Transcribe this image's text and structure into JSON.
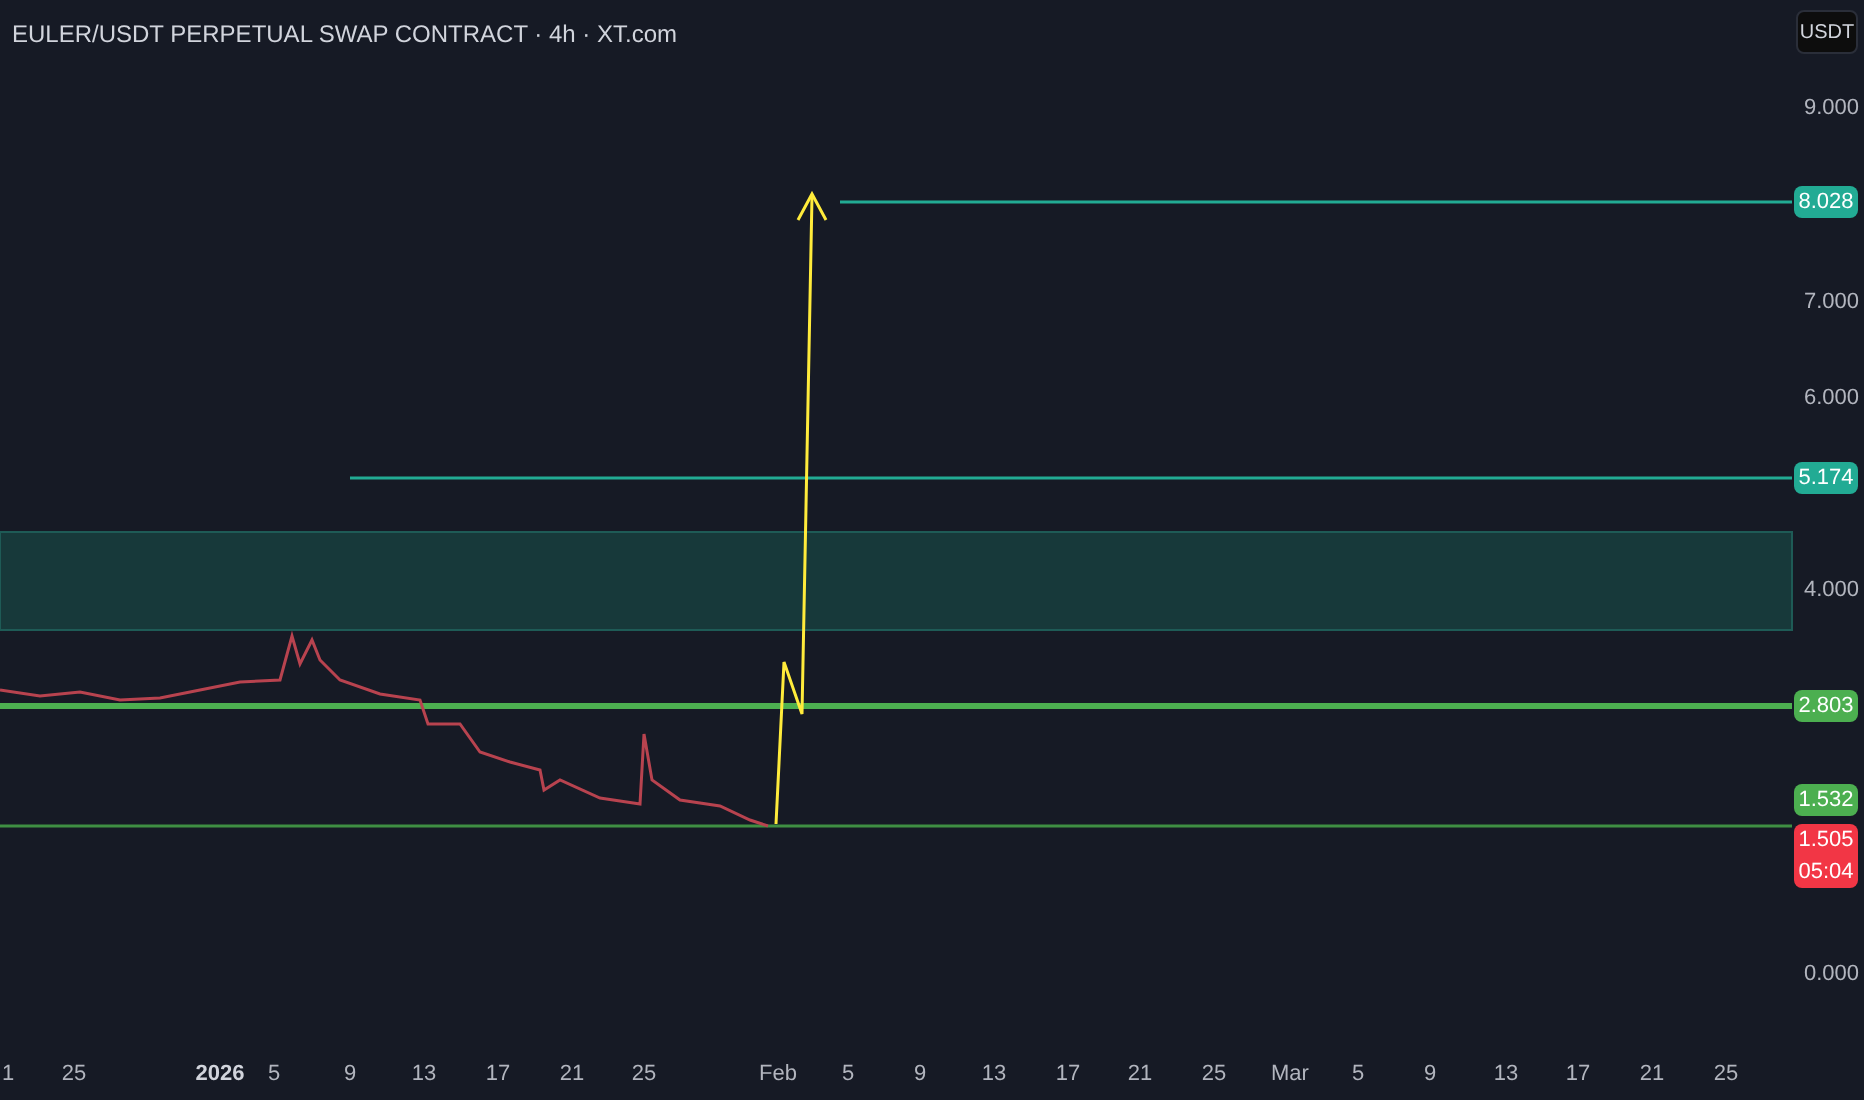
{
  "title": "EULER/USDT PERPETUAL SWAP CONTRACT · 4h · XT.com",
  "currency_button": "USDT",
  "price_ticks": [
    {
      "label": "9.000"
    },
    {
      "label": "7.000"
    },
    {
      "label": "6.000"
    },
    {
      "label": "4.000"
    },
    {
      "label": "0.000"
    }
  ],
  "price_labels": [
    {
      "text": "8.028",
      "color": "#22ab94"
    },
    {
      "text": "5.174",
      "color": "#22ab94"
    },
    {
      "text": "2.803",
      "color": "#4caf50"
    },
    {
      "text": "1.532",
      "color": "#4caf50"
    },
    {
      "text": "1.505",
      "sub": "05:04",
      "color": "#f23645"
    }
  ],
  "time_labels": [
    {
      "text": "1",
      "bold": false
    },
    {
      "text": "25",
      "bold": false
    },
    {
      "text": "2026",
      "bold": true
    },
    {
      "text": "5",
      "bold": false
    },
    {
      "text": "9",
      "bold": false
    },
    {
      "text": "13",
      "bold": false
    },
    {
      "text": "17",
      "bold": false
    },
    {
      "text": "21",
      "bold": false
    },
    {
      "text": "25",
      "bold": false
    },
    {
      "text": "Feb",
      "bold": false
    },
    {
      "text": "5",
      "bold": false
    },
    {
      "text": "9",
      "bold": false
    },
    {
      "text": "13",
      "bold": false
    },
    {
      "text": "17",
      "bold": false
    },
    {
      "text": "21",
      "bold": false
    },
    {
      "text": "25",
      "bold": false
    },
    {
      "text": "Mar",
      "bold": false
    },
    {
      "text": "5",
      "bold": false
    },
    {
      "text": "9",
      "bold": false
    },
    {
      "text": "13",
      "bold": false
    },
    {
      "text": "17",
      "bold": false
    },
    {
      "text": "21",
      "bold": false
    },
    {
      "text": "25",
      "bold": false
    }
  ]
}
